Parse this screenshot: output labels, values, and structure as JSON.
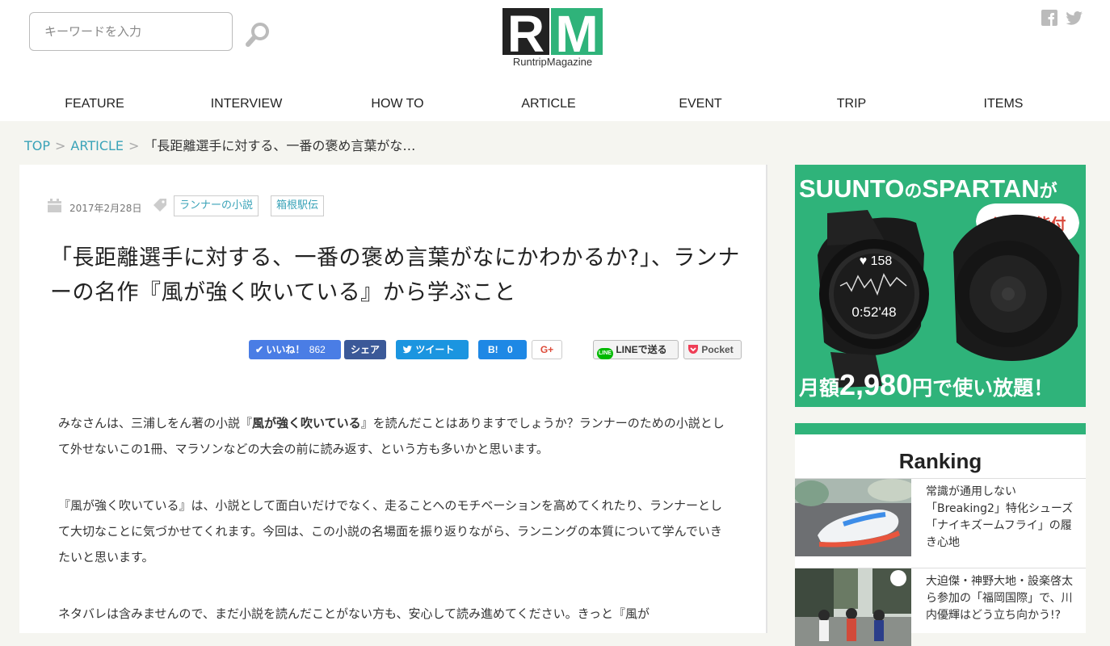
{
  "search": {
    "placeholder": "キーワードを入力"
  },
  "logo": {
    "letters": "RM",
    "name": "RuntripMagazine"
  },
  "nav": [
    "FEATURE",
    "INTERVIEW",
    "HOW TO",
    "ARTICLE",
    "EVENT",
    "TRIP",
    "ITEMS"
  ],
  "breadcrumb": {
    "top": "TOP",
    "section": "ARTICLE",
    "current": "「長距離選手に対する、一番の褒め言葉がな…"
  },
  "article": {
    "date": "2017年2月28日",
    "tags": [
      "ランナーの小説",
      "箱根駅伝"
    ],
    "title": "「長距離選手に対する、一番の褒め言葉がなにかわかるか?」、ランナーの名作『風が強く吹いている』から学ぶこと",
    "p1_a": "みなさんは、三浦しをん著の小説『",
    "p1_bold": "風が強く吹いている",
    "p1_b": "』を読んだことはありますでしょうか？ランナーのための小説として外せないこの1冊、マラソンなどの大会の前に読み返す、という方も多いかと思います。",
    "p2": "『風が強く吹いている』は、小説として面白いだけでなく、走ることへのモチベーションを高めてくれたり、ランナーとして大切なことに気づかせてくれます。今回は、この小説の名場面を振り返りながら、ランニングの本質について学んでいきたいと思います。",
    "p3": "ネタバレは含みませんので、まだ小説を読んだことがない方も、安心して読み進めてください。きっと『風が"
  },
  "share": {
    "like_label": "いいね！",
    "like_count": "862",
    "share_label": "シェア",
    "tweet_label": "ツイート",
    "hatena_label": "B!",
    "hatena_count": "0",
    "gplus_label": "G+",
    "line_label": "LINEで送る",
    "pocket_label": "Pocket"
  },
  "ad": {
    "headline_a": "SUUNTO",
    "headline_no1": "の",
    "headline_b": "SPARTAN",
    "headline_ga": "が",
    "badge": "心拍機能付",
    "watch_bpm": "158",
    "watch_time": "0:52'48",
    "bottom_a": "月額",
    "bottom_price": "2,980",
    "bottom_b": "円で使い放題！",
    "colors": {
      "green": "#2fb37a",
      "badge": "#d8473a"
    }
  },
  "ranking": {
    "title": "Ranking",
    "items": [
      {
        "text": "常識が通用しない「Breaking2」特化シューズ「ナイキズームフライ」の履き心地"
      },
      {
        "text": "大迫傑・神野大地・設楽啓太ら参加の「福岡国際」で、川内優輝はどう立ち向かう!?"
      }
    ]
  },
  "colors": {
    "accent": "#3aa3b8",
    "brand_green": "#2fb37a",
    "facebook": "#3b5998",
    "twitter": "#1b95e0"
  }
}
